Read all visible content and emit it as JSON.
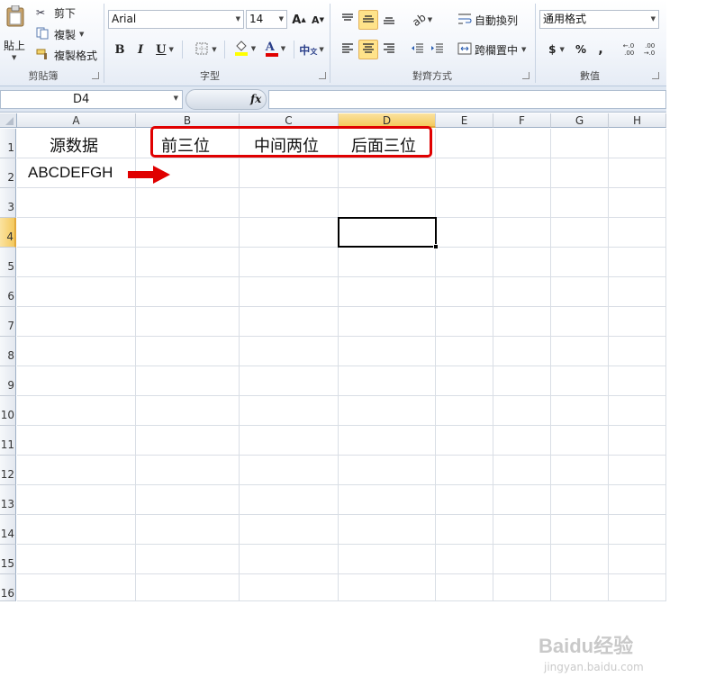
{
  "ribbon": {
    "clipboard": {
      "paste_label": "貼上",
      "cut_label": "剪下",
      "copy_label": "複製",
      "format_painter_label": "複製格式",
      "group_label": "剪貼簿"
    },
    "font": {
      "font_name": "Arial",
      "font_size": "14",
      "grow_label": "A",
      "shrink_label": "A",
      "bold_label": "B",
      "italic_label": "I",
      "underline_label": "U",
      "font_color_label": "A",
      "group_label": "字型"
    },
    "alignment": {
      "wrap_text_label": "自動換列",
      "merge_center_label": "跨欄置中",
      "group_label": "對齊方式"
    },
    "number": {
      "format_value": "通用格式",
      "currency_label": "$",
      "percent_label": "%",
      "comma_label": ",",
      "group_label": "數值"
    }
  },
  "formula_bar": {
    "name_box": "D4",
    "fx_label": "fx",
    "formula": ""
  },
  "columns": [
    "A",
    "B",
    "C",
    "D",
    "E",
    "F",
    "G",
    "H"
  ],
  "rows": [
    "1",
    "2",
    "3",
    "4",
    "5",
    "6",
    "7",
    "8",
    "9",
    "10",
    "11",
    "12",
    "13",
    "14",
    "15",
    "16"
  ],
  "active_cell": "D4",
  "cells": {
    "A1": "源数据",
    "B1": "前三位",
    "C1": "中间两位",
    "D1": "后面三位",
    "A2": "ABCDEFGH"
  },
  "annotations": {
    "highlight_color": "#e00000",
    "arrow_color": "#e00000"
  },
  "watermark": {
    "logo_text": "Baidu经验",
    "url_text": "jingyan.baidu.com"
  }
}
